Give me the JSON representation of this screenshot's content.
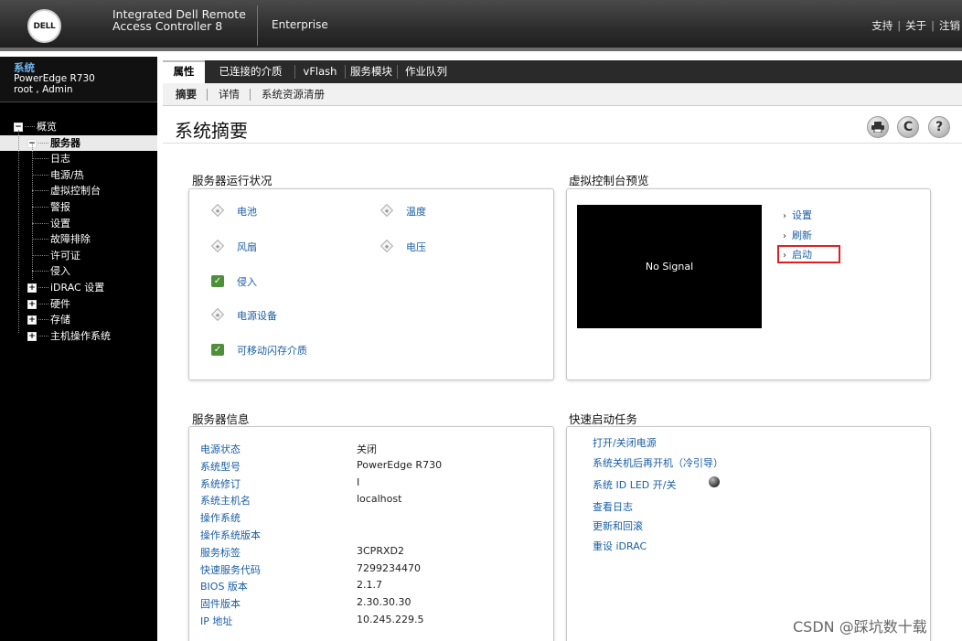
{
  "header": {
    "logo": "DELL",
    "product_line1": "Integrated Dell Remote",
    "product_line2": "Access Controller 8",
    "edition": "Enterprise",
    "links": [
      "支持",
      "关于",
      "注销"
    ]
  },
  "sidebar": {
    "system_title": "系统",
    "model": "PowerEdge R730",
    "user": "root , Admin",
    "tree": [
      {
        "label": "概览",
        "toggle": "−",
        "level": 0
      },
      {
        "label": "服务器",
        "toggle": "−",
        "level": 1,
        "selected": true
      },
      {
        "label": "日志",
        "level": 2
      },
      {
        "label": "电源/热",
        "level": 2
      },
      {
        "label": "虚拟控制台",
        "level": 2
      },
      {
        "label": "警报",
        "level": 2
      },
      {
        "label": "设置",
        "level": 2
      },
      {
        "label": "故障排除",
        "level": 2
      },
      {
        "label": "许可证",
        "level": 2
      },
      {
        "label": "侵入",
        "level": 2
      },
      {
        "label": "iDRAC 设置",
        "toggle": "+",
        "level": 1
      },
      {
        "label": "硬件",
        "toggle": "+",
        "level": 1
      },
      {
        "label": "存储",
        "toggle": "+",
        "level": 1
      },
      {
        "label": "主机操作系统",
        "toggle": "+",
        "level": 1
      }
    ]
  },
  "tabs": [
    "属性",
    "已连接的介质",
    "vFlash",
    "服务模块",
    "作业队列"
  ],
  "subtabs": [
    "摘要",
    "详情",
    "系统资源清册"
  ],
  "page_title": "系统摘要",
  "toolbar_icons": [
    "print-icon",
    "refresh-icon",
    "help-icon"
  ],
  "health": {
    "title": "服务器运行状况",
    "items": [
      {
        "label": "电池",
        "status": "unknown"
      },
      {
        "label": "温度",
        "status": "unknown"
      },
      {
        "label": "风扇",
        "status": "unknown"
      },
      {
        "label": "电压",
        "status": "unknown"
      },
      {
        "label": "侵入",
        "status": "ok"
      },
      {
        "label": "电源设备",
        "status": "unknown"
      },
      {
        "label": "可移动闪存介质",
        "status": "ok"
      }
    ]
  },
  "virtual_console": {
    "title": "虚拟控制台预览",
    "screen_text": "No Signal",
    "links": [
      "设置",
      "刷新",
      "启动"
    ]
  },
  "server_info": {
    "title": "服务器信息",
    "rows": [
      {
        "label": "电源状态",
        "value": "关闭"
      },
      {
        "label": "系统型号",
        "value": "PowerEdge R730"
      },
      {
        "label": "系统修订",
        "value": "I"
      },
      {
        "label": "系统主机名",
        "value": "localhost"
      },
      {
        "label": "操作系统",
        "value": ""
      },
      {
        "label": "操作系统版本",
        "value": ""
      },
      {
        "label": "服务标签",
        "value": "3CPRXD2"
      },
      {
        "label": "快速服务代码",
        "value": "7299234470"
      },
      {
        "label": "BIOS 版本",
        "value": "2.1.7"
      },
      {
        "label": "固件版本",
        "value": "2.30.30.30"
      },
      {
        "label": "IP 地址",
        "value": "10.245.229.5"
      }
    ]
  },
  "quick_launch": {
    "title": "快速启动任务",
    "items": [
      "打开/关闭电源",
      "系统关机后再开机（冷引导）",
      "系统 ID LED 开/关",
      "查看日志",
      "更新和回滚",
      "重设 iDRAC"
    ]
  },
  "watermark": "CSDN @踩坑数十载"
}
